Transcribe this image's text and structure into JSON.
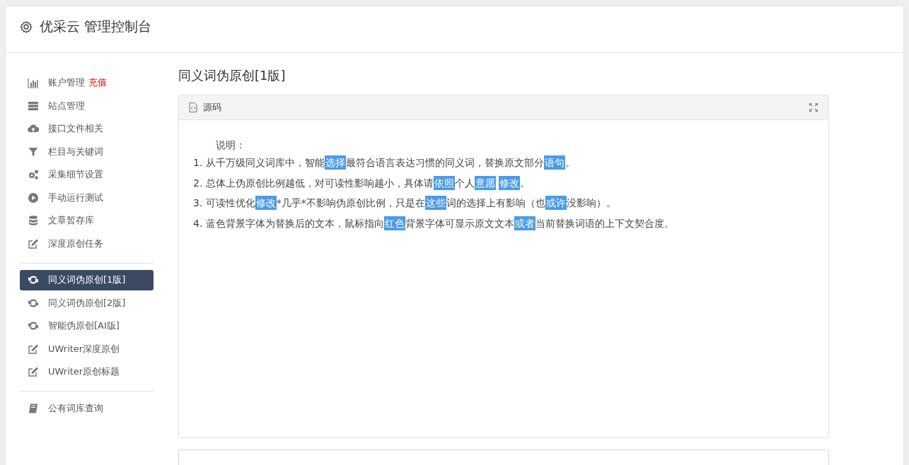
{
  "header": {
    "title": "优采云 管理控制台"
  },
  "sidebar": {
    "groups": [
      [
        {
          "kind": "chart",
          "label": "账户管理",
          "badge": "充值",
          "selected": false
        },
        {
          "kind": "server",
          "label": "站点管理",
          "selected": false
        },
        {
          "kind": "upload",
          "label": "接口文件相关",
          "selected": false
        },
        {
          "kind": "filter",
          "label": "栏目与关键词",
          "selected": false
        },
        {
          "kind": "gears",
          "label": "采集细节设置",
          "selected": false
        },
        {
          "kind": "play",
          "label": "手动运行测试",
          "selected": false
        },
        {
          "kind": "database",
          "label": "文章暂存库",
          "selected": false
        },
        {
          "kind": "edit",
          "label": "深度原创任务",
          "selected": false
        }
      ],
      [
        {
          "kind": "refresh",
          "label": "同义词伪原创[1版]",
          "selected": true
        },
        {
          "kind": "refresh",
          "label": "同义词伪原创[2版]",
          "selected": false
        },
        {
          "kind": "refresh",
          "label": "智能伪原创[AI版]",
          "selected": false
        },
        {
          "kind": "edit",
          "label": "UWriter深度原创",
          "selected": false
        },
        {
          "kind": "edit",
          "label": "UWriter原创标题",
          "selected": false
        }
      ],
      [
        {
          "kind": "book",
          "label": "公有词库查询",
          "selected": false
        }
      ]
    ]
  },
  "content": {
    "title": "同义词伪原创[1版]",
    "panel": {
      "heading": "源码",
      "intro": "说明：",
      "lines": [
        [
          {
            "text": "1. 从千万级同义词库中，智能",
            "replaced": false
          },
          {
            "text": "选择",
            "replaced": true
          },
          {
            "text": "最符合语言表达习惯的同义词，替换原文部分",
            "replaced": false
          },
          {
            "text": "语句",
            "replaced": true
          },
          {
            "text": "。",
            "replaced": false
          }
        ],
        [
          {
            "text": "2. 总体上伪原创比例越低，对可读性影响越小，具体请",
            "replaced": false
          },
          {
            "text": "依照",
            "replaced": true
          },
          {
            "text": "个人",
            "replaced": false
          },
          {
            "text": "意愿",
            "replaced": true
          },
          {
            "text": "修改",
            "replaced": true
          },
          {
            "text": "。",
            "replaced": false
          }
        ],
        [
          {
            "text": "3. 可读性优化",
            "replaced": false
          },
          {
            "text": "修改",
            "replaced": true
          },
          {
            "text": "*几乎*不影响伪原创比例，只是在",
            "replaced": false
          },
          {
            "text": "这些",
            "replaced": true
          },
          {
            "text": "词的选择上有影响（也",
            "replaced": false
          },
          {
            "text": "或许",
            "replaced": true
          },
          {
            "text": "没影响）。",
            "replaced": false
          }
        ],
        [
          {
            "text": "4. 蓝色背景字体为替换后的文本，鼠标指向",
            "replaced": false
          },
          {
            "text": "红色",
            "replaced": true
          },
          {
            "text": "背景字体可显示原文文本",
            "replaced": false
          },
          {
            "text": "或者",
            "replaced": true
          },
          {
            "text": "当前替换词语的上下文契合度。",
            "replaced": false
          }
        ]
      ]
    }
  }
}
